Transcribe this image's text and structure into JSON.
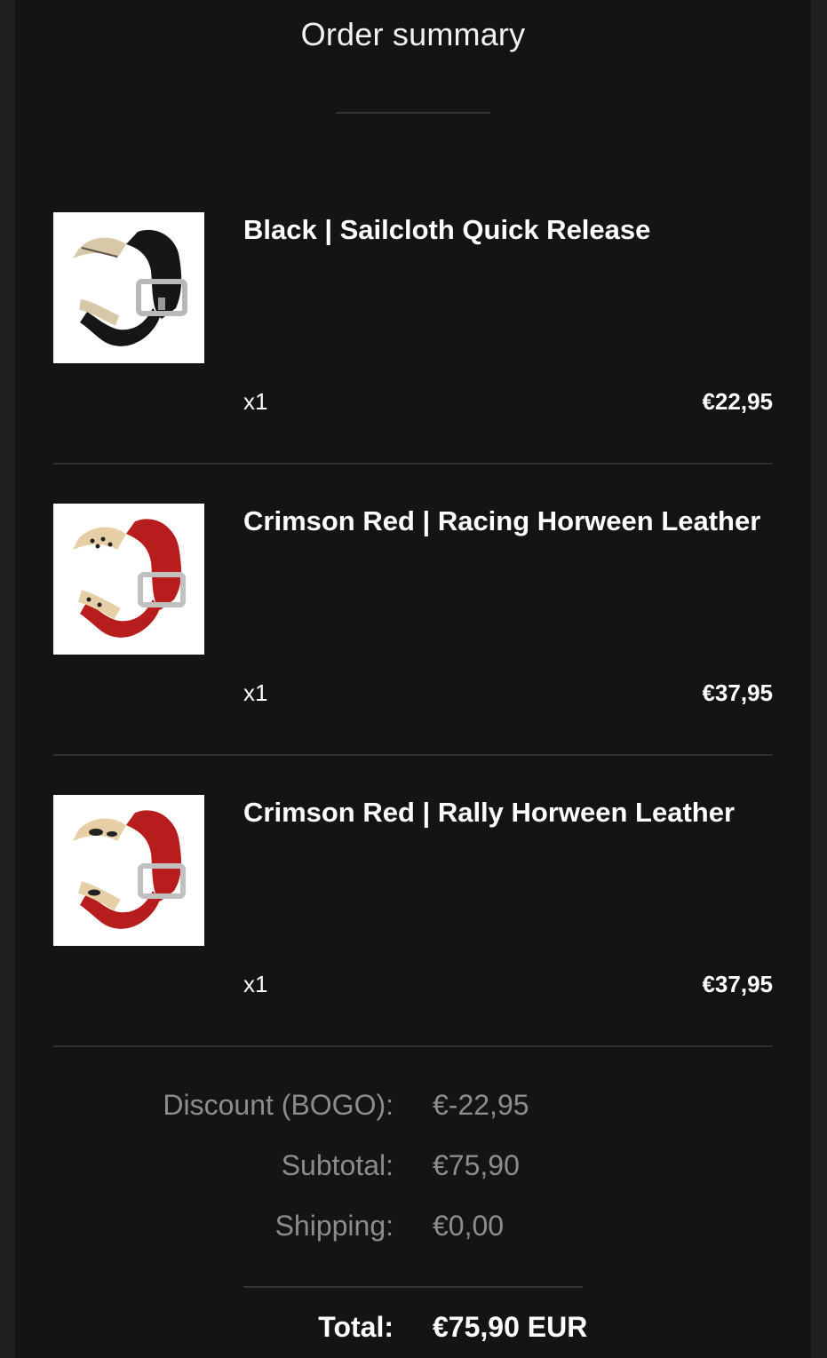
{
  "title": "Order summary",
  "items": [
    {
      "name": "Black | Sailcloth Quick Release",
      "quantity": "x1",
      "price": "€22,95",
      "strap_color": "#161616"
    },
    {
      "name": "Crimson Red | Racing Horween Leather",
      "quantity": "x1",
      "price": "€37,95",
      "strap_color": "#b81d1d"
    },
    {
      "name": "Crimson Red | Rally Horween Leather",
      "quantity": "x1",
      "price": "€37,95",
      "strap_color": "#b81d1d"
    }
  ],
  "summary": {
    "discount_label": "Discount (BOGO):",
    "discount_value": "€-22,95",
    "subtotal_label": "Subtotal:",
    "subtotal_value": "€75,90",
    "shipping_label": "Shipping:",
    "shipping_value": "€0,00",
    "total_label": "Total:",
    "total_value": "€75,90 EUR"
  },
  "colors": {
    "background": "#141414",
    "text_primary": "#ffffff",
    "text_muted": "#8c8c8c",
    "divider": "#2e2e2e"
  }
}
